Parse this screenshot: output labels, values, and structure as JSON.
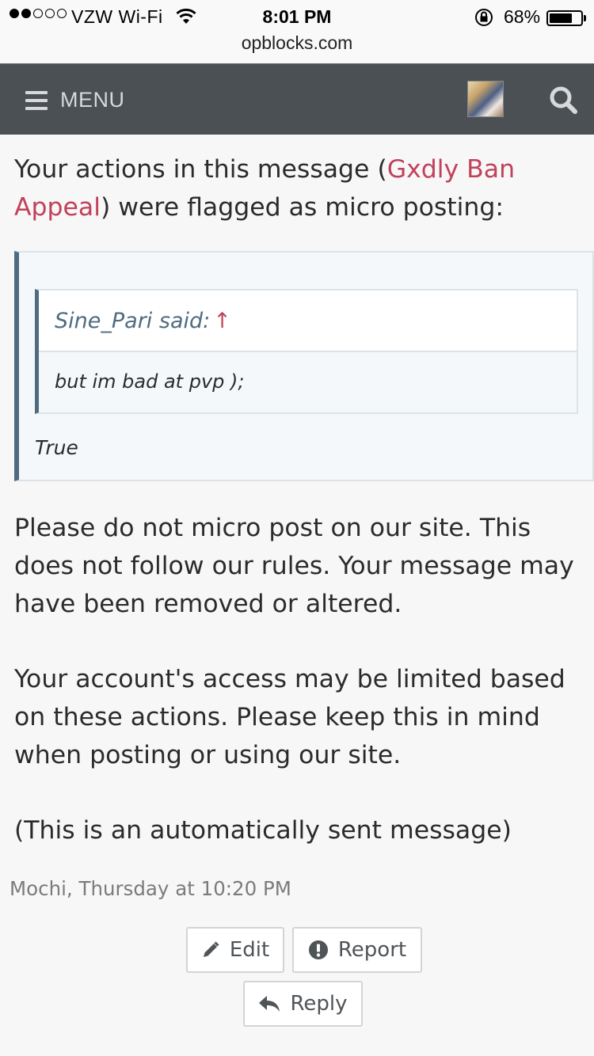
{
  "status_bar": {
    "carrier": "VZW Wi-Fi",
    "time": "8:01 PM",
    "battery": "68%",
    "battery_level": 0.68,
    "url": "opblocks.com"
  },
  "nav": {
    "menu_label": "MENU",
    "background": "#4b5054"
  },
  "message": {
    "intro_before": "Your actions in this message (",
    "thread_link": "Gxdly Ban Appeal",
    "intro_after": ") were flagged as micro posting:",
    "quote": {
      "author": "Sine_Pari said:",
      "arrow": "↑",
      "quoted_text": "but im bad at pvp );",
      "reply": "True"
    },
    "paragraph1": "Please do not micro post on our site. This does not follow our rules. Your message may have been removed or altered.",
    "paragraph2": "Your account's access may be limited based on these actions. Please keep this in mind when posting or using our site.",
    "paragraph3": "(This is an automatically sent message)",
    "meta": "Mochi, Thursday at 10:20 PM"
  },
  "actions": {
    "edit": "Edit",
    "report": "Report",
    "reply": "Reply"
  },
  "colors": {
    "link": "#c1415a",
    "quote_border": "#4f6b80",
    "meta_text": "#7b7b7b"
  }
}
